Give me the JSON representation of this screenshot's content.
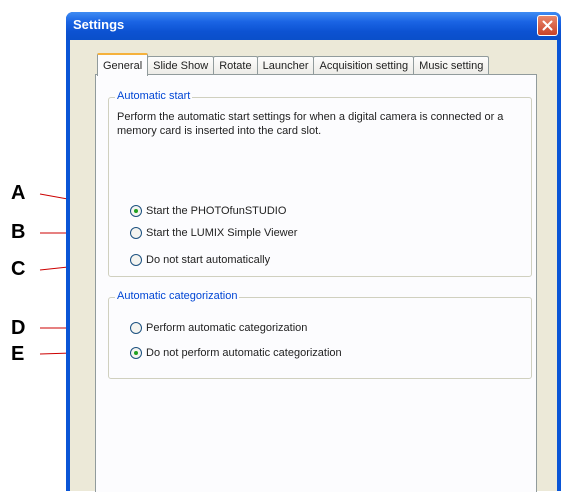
{
  "window": {
    "title": "Settings"
  },
  "tabs": [
    {
      "label": "General",
      "active": true
    },
    {
      "label": "Slide Show",
      "active": false
    },
    {
      "label": "Rotate",
      "active": false
    },
    {
      "label": "Launcher",
      "active": false
    },
    {
      "label": "Acquisition setting",
      "active": false
    },
    {
      "label": "Music setting",
      "active": false
    }
  ],
  "automatic_start": {
    "legend": "Automatic start",
    "description": "Perform the automatic start settings for when a digital camera is connected or a memory card is inserted into the card slot.",
    "options": [
      {
        "label": "Start the PHOTOfunSTUDIO",
        "checked": true
      },
      {
        "label": "Start the LUMIX Simple Viewer",
        "checked": false
      },
      {
        "label": "Do not start automatically",
        "checked": false
      }
    ]
  },
  "automatic_categorization": {
    "legend": "Automatic categorization",
    "options": [
      {
        "label": "Perform automatic categorization",
        "checked": false
      },
      {
        "label": "Do not perform automatic categorization",
        "checked": true
      }
    ]
  },
  "callouts": [
    "A",
    "B",
    "C",
    "D",
    "E"
  ],
  "colors": {
    "title_bar": "#0a55d6",
    "group_legend": "#0046d5",
    "active_tab_accent": "#f5b13c",
    "radio_dot": "#21a121",
    "callout_line": "#cc0000",
    "close_button": "#c9432a"
  }
}
